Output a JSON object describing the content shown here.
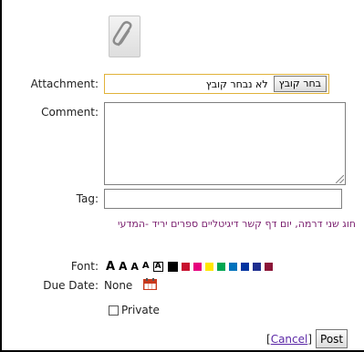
{
  "attachment": {
    "label": "Attachment:",
    "choose_button": "בחר קובץ",
    "status": "לא נבחר קובץ"
  },
  "comment": {
    "label": "Comment:",
    "value": ""
  },
  "tag": {
    "label": "Tag:",
    "value": "",
    "suggestions": "חוג שני דרמה, יום דף קשר דיגיטליים ספרים יריד -המדעי"
  },
  "font": {
    "label": "Font:",
    "sizes": [
      "A",
      "A",
      "A",
      "A",
      "A"
    ],
    "colors": [
      "#000000",
      "#c8102e",
      "#e6007e",
      "#ffe600",
      "#00a651",
      "#0072bc",
      "#0033a0",
      "#1f2f8f",
      "#8b1538"
    ]
  },
  "due_date": {
    "label": "Due Date:",
    "value": "None",
    "icon": "calendar-icon"
  },
  "private": {
    "label": "Private",
    "checked": false
  },
  "actions": {
    "open_bracket": "[",
    "cancel": "Cancel",
    "close_bracket": "]",
    "post": "Post"
  },
  "icons": {
    "attachment": "paperclip-icon"
  }
}
